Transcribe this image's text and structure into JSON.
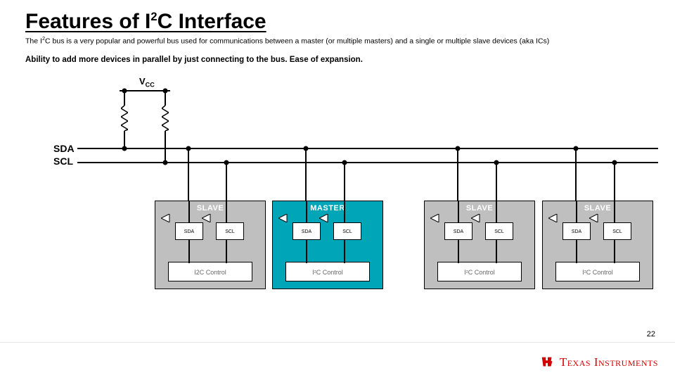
{
  "title_pre": "Features of I",
  "title_sup": "2",
  "title_post": "C Interface",
  "desc_pre": "The I",
  "desc_sup": "2",
  "desc_post": "C bus is a very popular and powerful bus used for communications between a master (or multiple masters) and a single or multiple slave devices (aka ICs)",
  "bullet": "Ability to add more devices in parallel by just connecting to the bus.  Ease of expansion.",
  "vcc_pre": "V",
  "vcc_sub": "CC",
  "bus": {
    "sda": "SDA",
    "scl": "SCL"
  },
  "devices": [
    {
      "type": "slave",
      "label": "SLAVE",
      "sda": "SDA",
      "scl": "SCL",
      "ctrl": "I2C Control"
    },
    {
      "type": "master",
      "label": "MASTER",
      "sda": "SDA",
      "scl": "SCL",
      "ctrl": "I²C Control"
    },
    {
      "type": "slave",
      "label": "SLAVE",
      "sda": "SDA",
      "scl": "SCL",
      "ctrl": "I²C Control"
    },
    {
      "type": "slave",
      "label": "SLAVE",
      "sda": "SDA",
      "scl": "SCL",
      "ctrl": "I²C Control"
    }
  ],
  "page_number": "22",
  "logo_text": "Texas Instruments"
}
